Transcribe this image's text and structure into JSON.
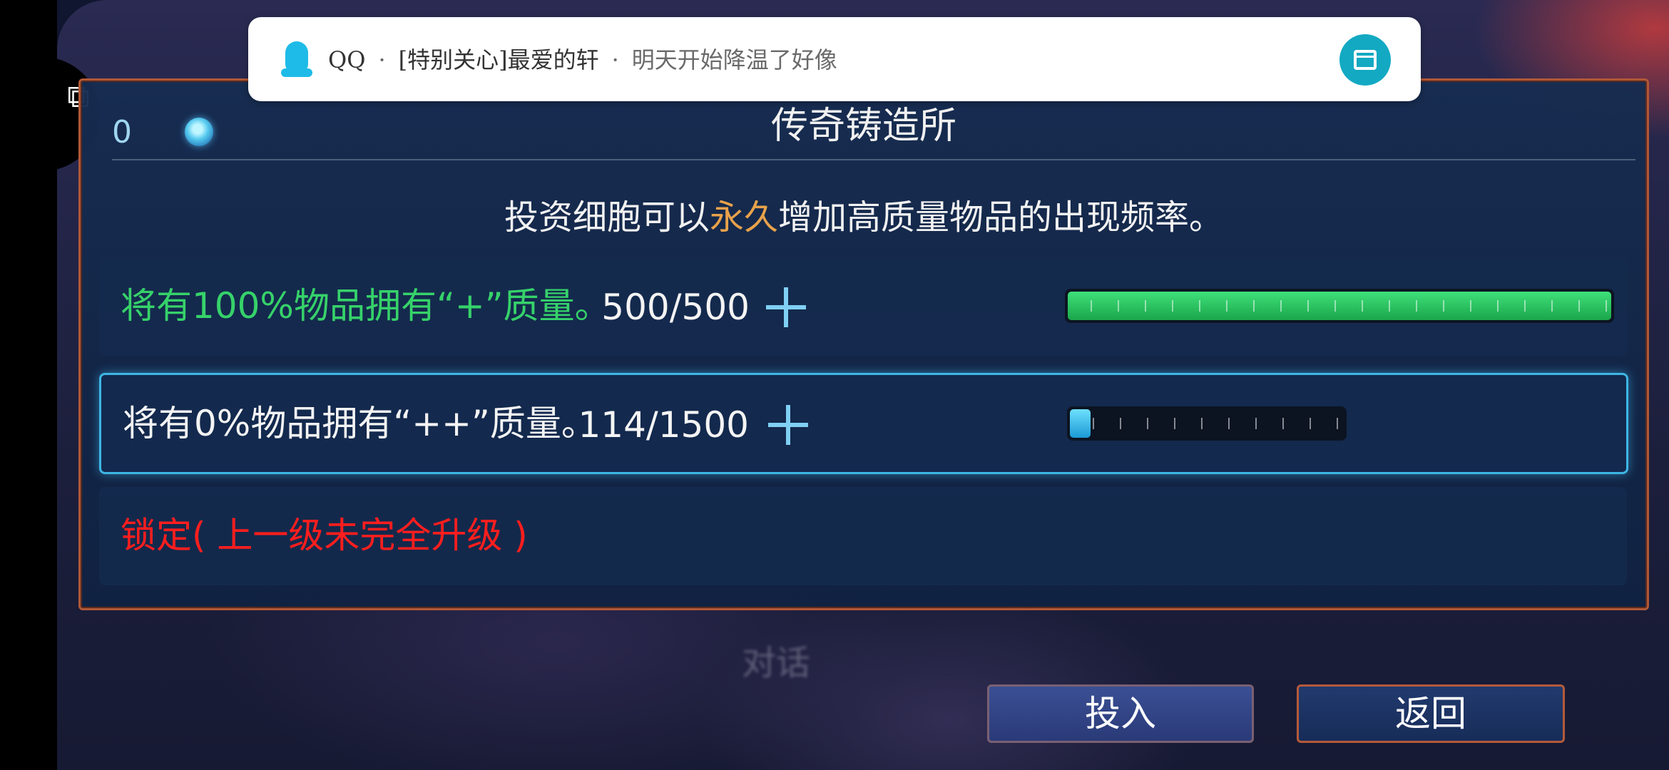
{
  "notification": {
    "app": "QQ",
    "sender": "[特别关心]最爱的轩",
    "message": "明天开始降温了好像",
    "separator": "·",
    "icon": "qq-penguin-icon",
    "action_icon": "floating-window-icon",
    "accent": "#13a9c3"
  },
  "panel": {
    "cell_count": "0",
    "cell_icon": "cell-icon",
    "title": "传奇铸造所",
    "subtitle_before": "投资细胞可以",
    "subtitle_highlight": "永久",
    "subtitle_after": "增加高质量物品的出现频率。"
  },
  "rows": [
    {
      "text": "将有100%物品拥有“+”质量。",
      "progress": "500/500",
      "fill_fraction": 1.0,
      "color": "#36d26a"
    },
    {
      "text": "将有0%物品拥有“++”质量。",
      "progress": "114/1500",
      "fill_fraction": 0.076,
      "color": "#f4f4f4"
    },
    {
      "text": "锁定( 上一级未完全升级 )",
      "color": "#ff1e1e"
    }
  ],
  "dialog_hint": "对话",
  "buttons": {
    "invest": "投入",
    "back": "返回"
  },
  "system": {
    "puzzle_icon": "puzzle-icon"
  }
}
